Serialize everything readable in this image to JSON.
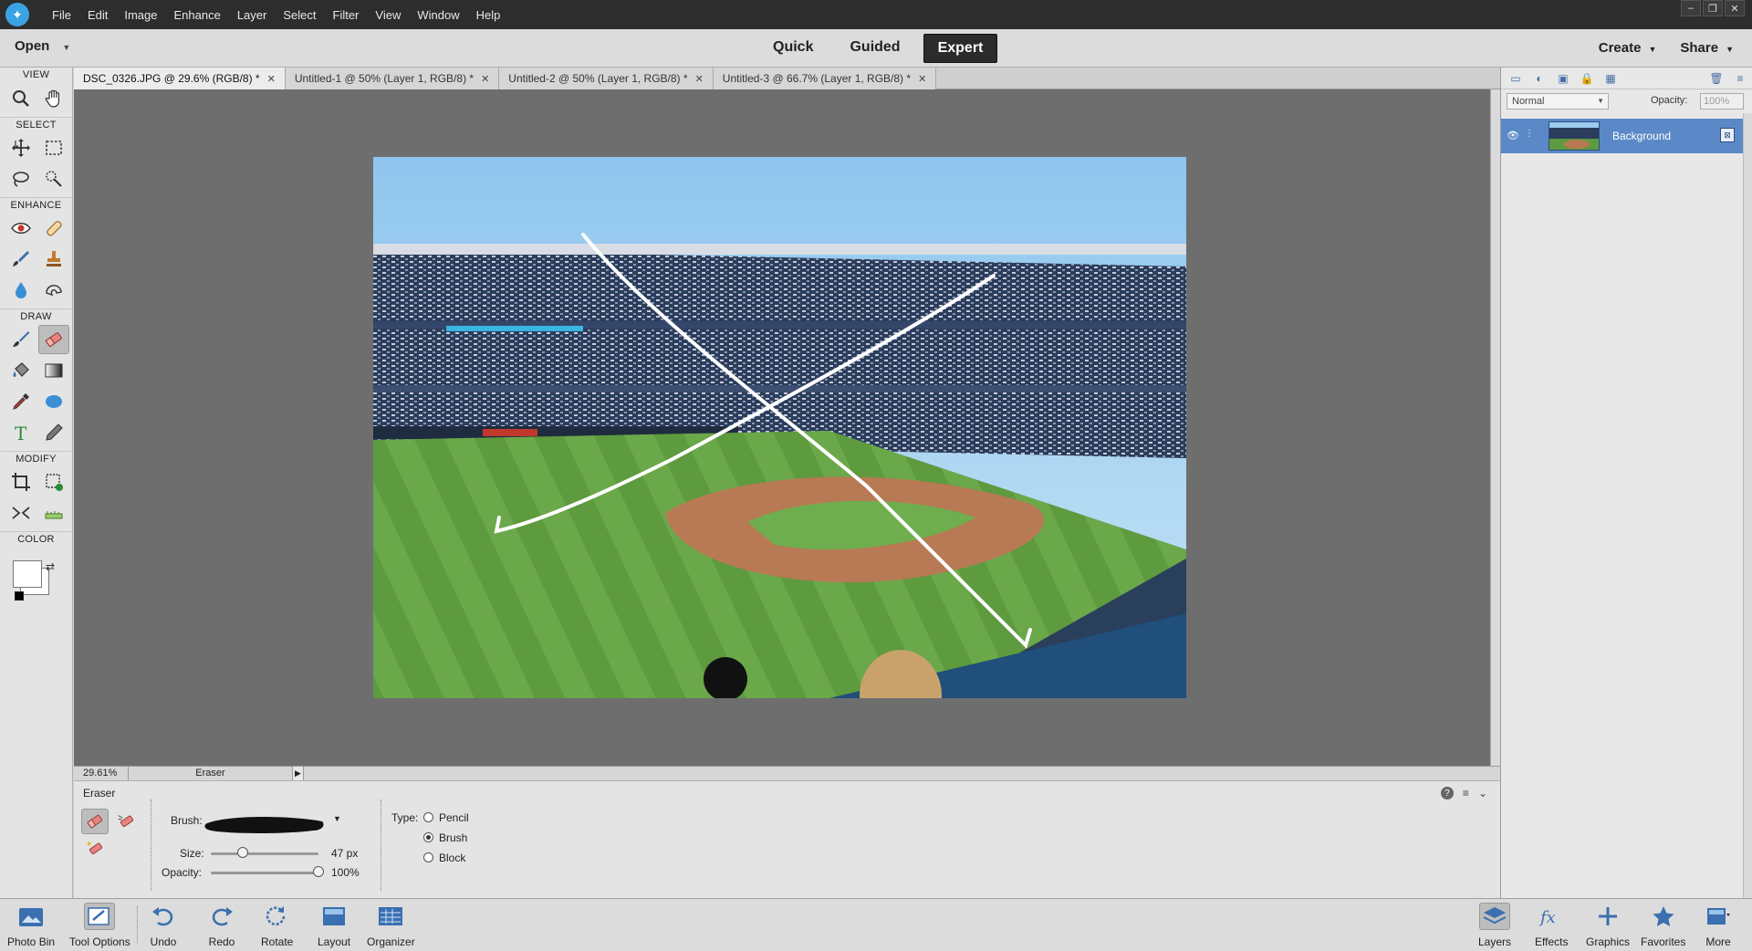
{
  "menubar": {
    "items": [
      "File",
      "Edit",
      "Image",
      "Enhance",
      "Layer",
      "Select",
      "Filter",
      "View",
      "Window",
      "Help"
    ]
  },
  "modebar": {
    "open_label": "Open",
    "modes": [
      "Quick",
      "Guided",
      "Expert"
    ],
    "active_mode": "Expert",
    "create_label": "Create",
    "share_label": "Share"
  },
  "toolbox": {
    "sections": [
      "VIEW",
      "SELECT",
      "ENHANCE",
      "DRAW",
      "MODIFY",
      "COLOR"
    ],
    "active_tool": "eraser-tool"
  },
  "tabs": [
    {
      "label": "DSC_0326.JPG @ 29.6% (RGB/8) *",
      "active": true
    },
    {
      "label": "Untitled-1 @ 50% (Layer 1, RGB/8) *",
      "active": false
    },
    {
      "label": "Untitled-2 @ 50% (Layer 1, RGB/8) *",
      "active": false
    },
    {
      "label": "Untitled-3 @ 66.7% (Layer 1, RGB/8) *",
      "active": false
    }
  ],
  "status": {
    "zoom": "29.61%",
    "tool_name": "Eraser"
  },
  "tool_options": {
    "title": "Eraser",
    "brush_label": "Brush:",
    "size_label": "Size:",
    "size_value": "47 px",
    "size_fraction": 0.3,
    "opacity_label": "Opacity:",
    "opacity_value": "100%",
    "opacity_fraction": 1.0,
    "type_label": "Type:",
    "types": [
      "Pencil",
      "Brush",
      "Block"
    ],
    "selected_type": "Brush"
  },
  "layers_panel": {
    "blend_mode": "Normal",
    "opacity_label": "Opacity:",
    "opacity_value": "100%",
    "layers": [
      {
        "name": "Background",
        "selected": true
      }
    ]
  },
  "bottombar": {
    "left_items": [
      "Photo Bin",
      "Tool Options",
      "Undo",
      "Redo",
      "Rotate",
      "Layout",
      "Organizer"
    ],
    "right_items": [
      "Layers",
      "Effects",
      "Graphics",
      "Favorites",
      "More"
    ]
  },
  "colors": {
    "accent_selected_layer": "#5b89c7",
    "canvas_background": "#6e6e6e",
    "icon_blue": "#3a6fb0"
  }
}
